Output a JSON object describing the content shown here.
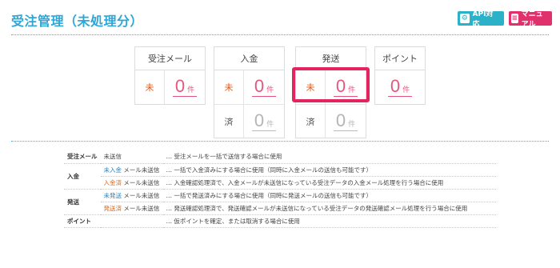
{
  "page": {
    "title": "受注管理（未処理分）"
  },
  "buttons": {
    "api": {
      "label": "API対応",
      "color": "#2bb2c8"
    },
    "manual": {
      "label": "マニュアル",
      "color": "#e0316c"
    }
  },
  "cards": [
    {
      "header": "受注メール",
      "rows": [
        {
          "label": "未",
          "count": "0",
          "unit": "件"
        }
      ]
    },
    {
      "header": "入金",
      "rows": [
        {
          "label": "未",
          "count": "0",
          "unit": "件"
        },
        {
          "label": "済",
          "count": "0",
          "unit": "件"
        }
      ]
    },
    {
      "header": "発送",
      "rows": [
        {
          "label": "未",
          "count": "0",
          "unit": "件"
        },
        {
          "label": "済",
          "count": "0",
          "unit": "件"
        }
      ]
    },
    {
      "header": "ポイント",
      "rows": [
        {
          "count": "0",
          "unit": "件"
        }
      ]
    }
  ],
  "legend": {
    "rows": [
      {
        "category": "受注メール",
        "status": "",
        "status_rest": "未送信",
        "desc": "… 受注メールを一括で送信する場合に使用"
      },
      {
        "category": "入金",
        "status": "未入金",
        "status_rest": "メール未送信",
        "desc": "… 一括で入金済みにする場合に使用（同時に入金メールの送信も可能です）"
      },
      {
        "category": "",
        "status": "入金済",
        "status_rest": "メール未送信",
        "desc": "… 入金確認処理済で、入金メールが未送信になっている受注データの入金メール処理を行う場合に使用"
      },
      {
        "category": "発送",
        "status": "未発送",
        "status_rest": "メール未送信",
        "desc": "… 一括で発送済みにする場合に使用（同時に発送メールの送信も可能です）"
      },
      {
        "category": "",
        "status": "発送済",
        "status_rest": "メール未送信",
        "desc": "… 発送確認処理済で、発送確認メールが未送信になっている受注データの発送確認メール処理を行う場合に使用"
      },
      {
        "category": "ポイント",
        "status": "",
        "status_rest": "",
        "desc": "… 仮ポイントを確定、または取消する場合に使用"
      }
    ]
  },
  "colors": {
    "accent": "#2ea6d6",
    "count": "#e8557f",
    "highlight": "#e3245f",
    "unsent": "#e05a1a"
  }
}
